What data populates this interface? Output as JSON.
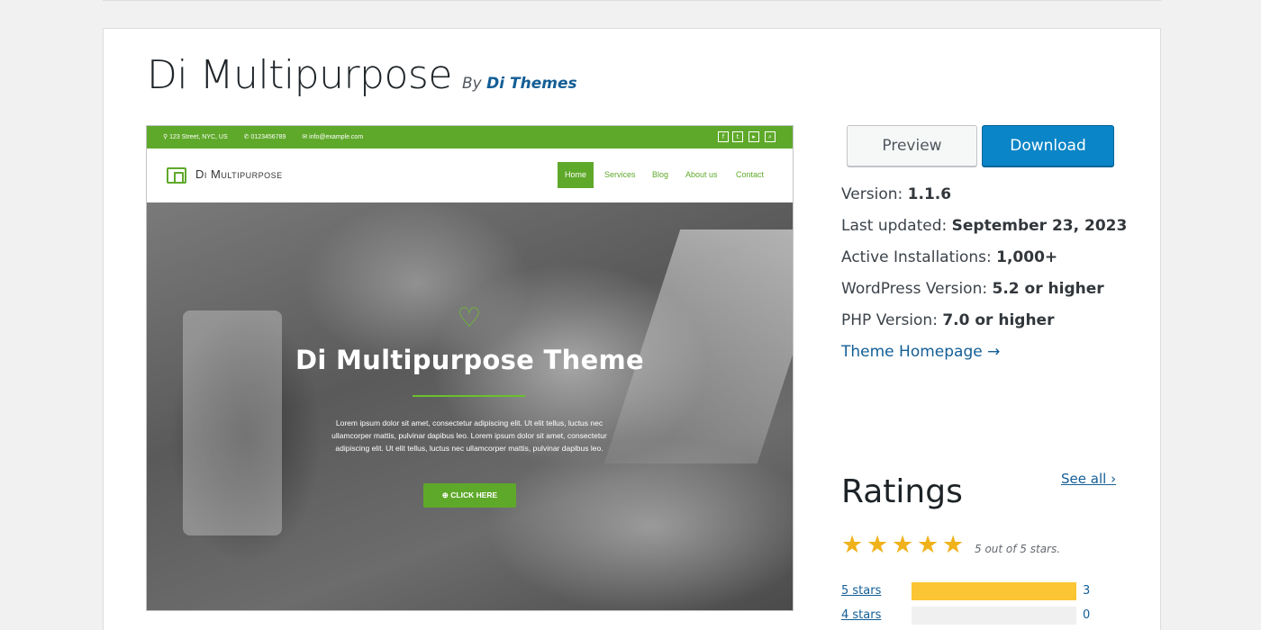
{
  "theme": {
    "title": "Di Multipurpose",
    "by_prefix": "By",
    "author": "Di Themes"
  },
  "screenshot": {
    "topbar": {
      "address": "123 Street, NYC, US",
      "phone": "0123456789",
      "email": "info@example.com",
      "social_icons": [
        "facebook-icon",
        "twitter-icon",
        "youtube-icon",
        "search-icon"
      ]
    },
    "logo_text": "Di Multipurpose",
    "nav": [
      "Home",
      "Services",
      "Blog",
      "About us",
      "Contact"
    ],
    "hero_title": "Di Multipurpose Theme",
    "hero_text": "Lorem ipsum dolor sit amet, consectetur adipiscing elit. Ut elit tellus, luctus nec ullamcorper mattis, pulvinar dapibus leo. Lorem ipsum dolor sit amet, consectetur adipiscing elit. Ut elit tellus, luctus nec ullamcorper mattis, pulvinar dapibus leo.",
    "hero_button": "CLICK HERE"
  },
  "actions": {
    "preview": "Preview",
    "download": "Download"
  },
  "meta": {
    "version_label": "Version:",
    "version": "1.1.6",
    "updated_label": "Last updated:",
    "updated": "September 23, 2023",
    "installs_label": "Active Installations:",
    "installs": "1,000+",
    "wp_label": "WordPress Version:",
    "wp": "5.2 or higher",
    "php_label": "PHP Version:",
    "php": "7.0 or higher",
    "homepage": "Theme Homepage →"
  },
  "ratings": {
    "heading": "Ratings",
    "see_all": "See all",
    "stars_text": "5 out of 5 stars.",
    "rating": 5,
    "bars": [
      {
        "label": "5 stars",
        "count": "3",
        "fraction": 1.0
      },
      {
        "label": "4 stars",
        "count": "0",
        "fraction": 0.0
      }
    ]
  },
  "colors": {
    "accent": "#0a85c7",
    "link": "#135e96",
    "theme_green": "#5fa92a",
    "star": "#f0b21b",
    "bar_fill": "#fcc533"
  }
}
